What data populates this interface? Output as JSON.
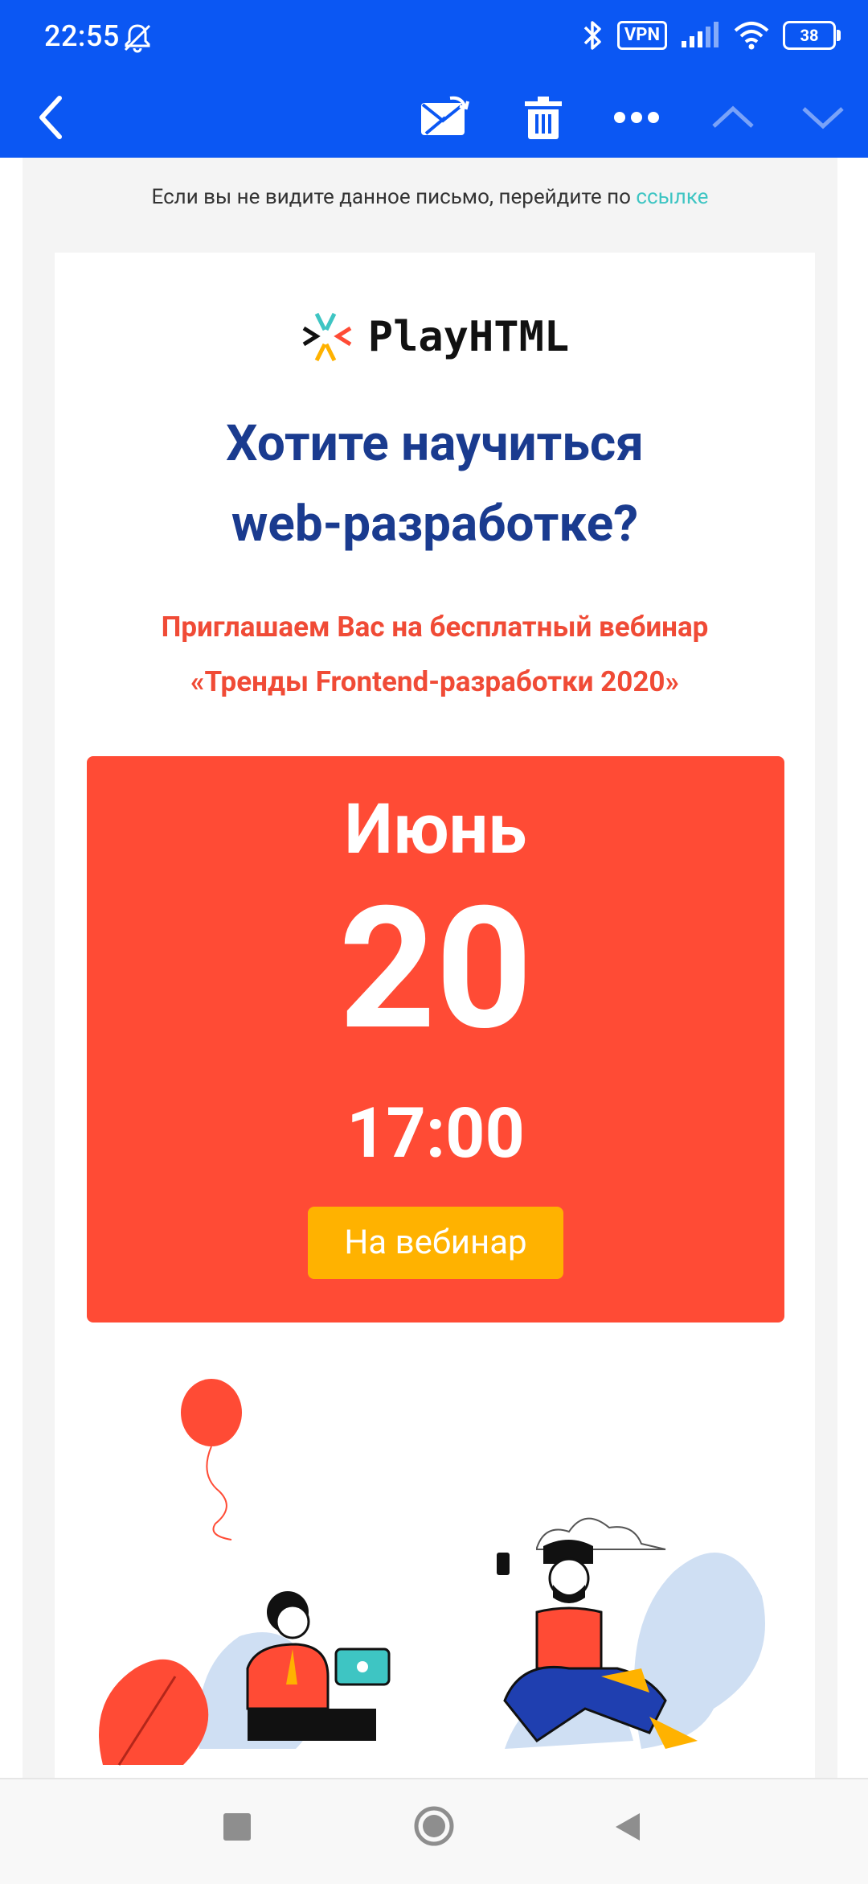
{
  "status_bar": {
    "time": "22:55",
    "vpn_label": "VPN",
    "battery": "38",
    "icons": [
      "muted-notification-icon",
      "bluetooth-icon",
      "signal-icon",
      "wifi-icon",
      "battery-icon"
    ]
  },
  "app_bar": {
    "icons": [
      "back-icon",
      "mark-unread-icon",
      "delete-icon",
      "more-icon",
      "previous-icon",
      "next-icon"
    ]
  },
  "email": {
    "preheader_text": "Если вы не видите данное письмо, перейдите по ",
    "preheader_link": "ссылке",
    "logo_text": "PlayHTML",
    "headline_line1": "Хотите научиться",
    "headline_line2": "web-разработке?",
    "invite_line1": "Приглашаем Вас на бесплатный вебинар",
    "invite_line2": "«Тренды Frontend-разработки 2020»",
    "date": {
      "month": "Июнь",
      "day": "20",
      "time": "17:00",
      "button_label": "На вебинар"
    }
  },
  "colors": {
    "app_bar": "#0b57f3",
    "headline": "#1a3b8f",
    "accent_red": "#ff4b35",
    "button_yellow": "#ffb200",
    "link_teal": "#3ec5c3"
  },
  "nav_bar": {
    "icons": [
      "recents-icon",
      "home-icon",
      "back-nav-icon"
    ]
  }
}
